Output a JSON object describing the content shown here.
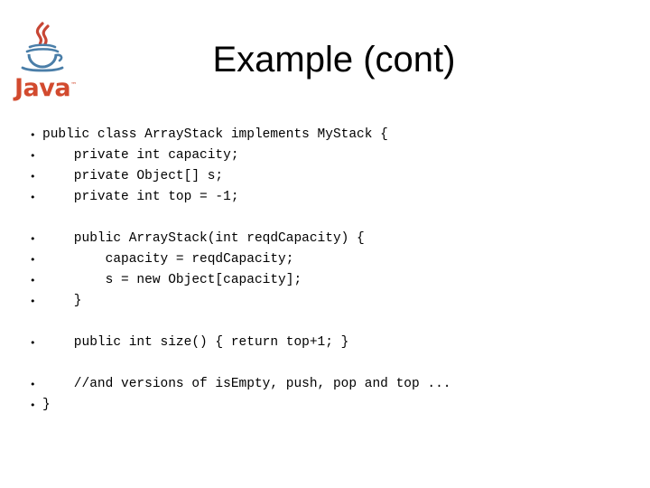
{
  "slide": {
    "title": "Example (cont)",
    "background_color": "#ffffff",
    "text_color": "#000000"
  },
  "logo": {
    "name": "java-logo",
    "wordmark": "Java",
    "trademark": "™",
    "steam_color": "#c74634",
    "cup_color": "#4a7ea8",
    "wordmark_color": "#d24a2e"
  },
  "bullet": {
    "glyph": "•"
  },
  "code": {
    "lines": [
      {
        "type": "bullet",
        "indent": 0,
        "text": "public class ArrayStack implements MyStack {"
      },
      {
        "type": "bullet",
        "indent": 4,
        "text": "private int capacity;"
      },
      {
        "type": "bullet",
        "indent": 4,
        "text": "private Object[] s;"
      },
      {
        "type": "bullet",
        "indent": 4,
        "text": "private int top = -1;"
      },
      {
        "type": "spacer",
        "indent": 0,
        "text": ""
      },
      {
        "type": "bullet",
        "indent": 4,
        "text": "public ArrayStack(int reqdCapacity) {"
      },
      {
        "type": "bullet",
        "indent": 8,
        "text": "capacity = reqdCapacity;"
      },
      {
        "type": "bullet",
        "indent": 8,
        "text": "s = new Object[capacity];"
      },
      {
        "type": "bullet",
        "indent": 4,
        "text": "}"
      },
      {
        "type": "spacer",
        "indent": 0,
        "text": ""
      },
      {
        "type": "bullet",
        "indent": 4,
        "text": "public int size() { return top+1; }"
      },
      {
        "type": "spacer",
        "indent": 0,
        "text": ""
      },
      {
        "type": "bullet",
        "indent": 4,
        "text": "//and versions of isEmpty, push, pop and top ..."
      },
      {
        "type": "bullet",
        "indent": 0,
        "text": "}"
      }
    ]
  }
}
